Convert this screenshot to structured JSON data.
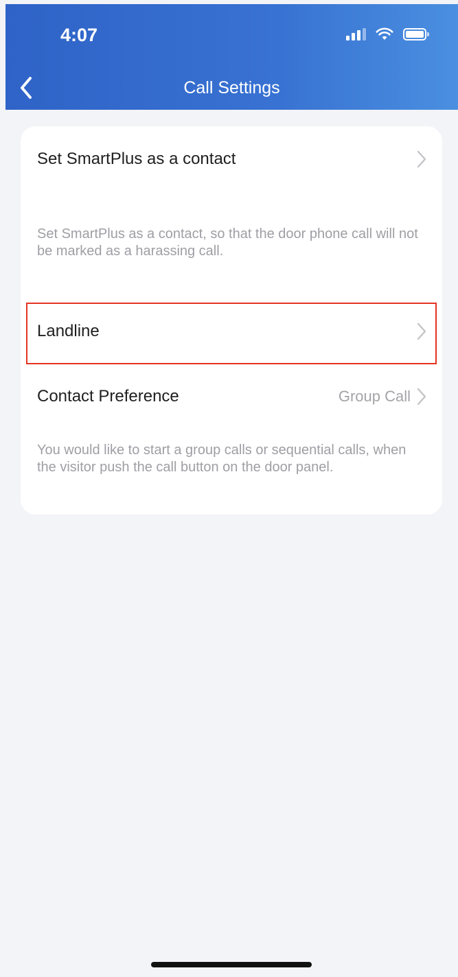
{
  "status_bar": {
    "time": "4:07",
    "icons": [
      "signal-icon",
      "wifi-icon",
      "battery-icon"
    ]
  },
  "nav": {
    "back_icon": "back-chevron-icon",
    "title": "Call Settings"
  },
  "settings": {
    "smartplus_contact": {
      "label": "Set SmartPlus as a contact",
      "description": "Set SmartPlus as a contact, so that the door phone call will not be marked as a harassing call."
    },
    "landline": {
      "label": "Landline"
    },
    "contact_preference": {
      "label": "Contact Preference",
      "value": "Group Call",
      "description": "You would like to start a group calls or sequential calls, when the visitor push the call button on the door panel."
    }
  },
  "colors": {
    "header_gradient_start": "#2f63c7",
    "header_gradient_end": "#4a8fe0",
    "highlight": "#e63222",
    "background": "#f3f4f8"
  }
}
